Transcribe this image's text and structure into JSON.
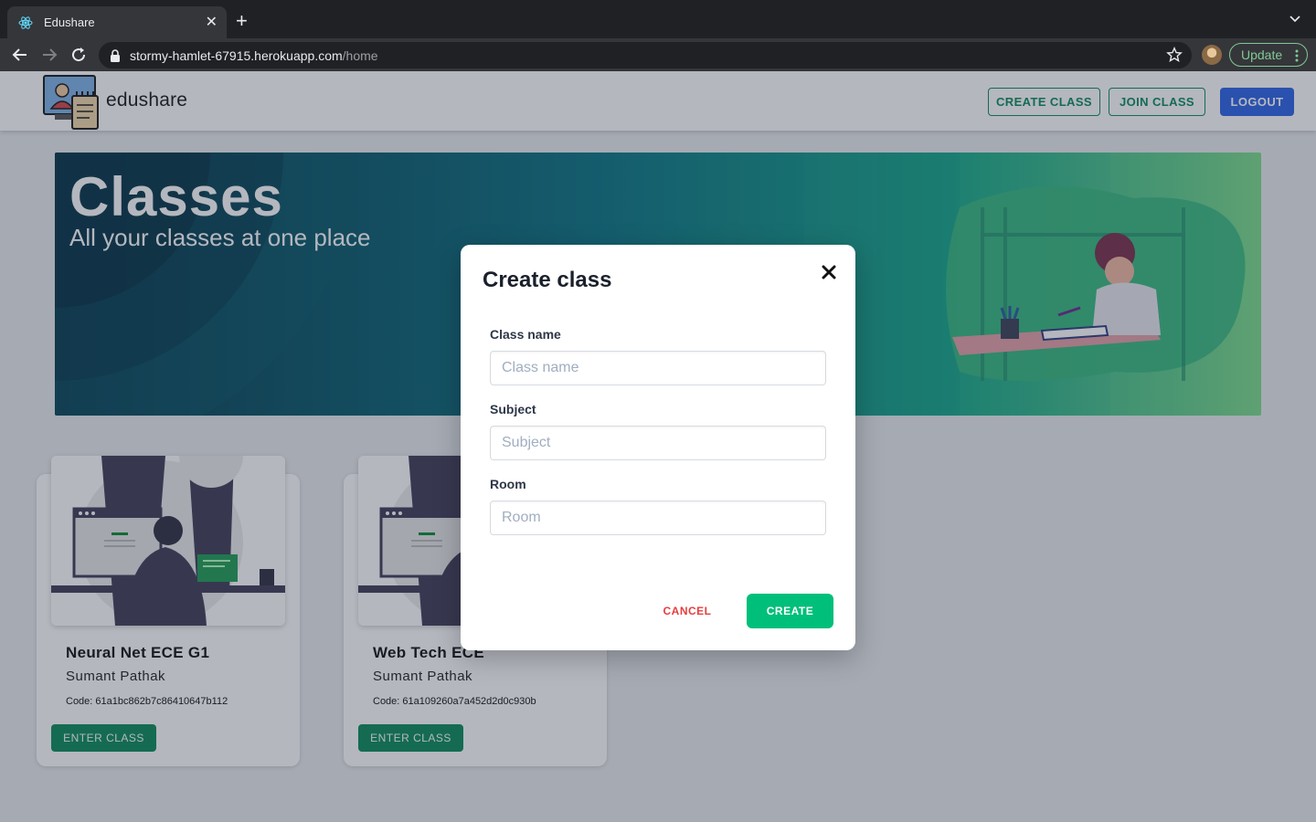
{
  "browser": {
    "tab_title": "Edushare",
    "url_host": "stormy-hamlet-67915.herokuapp.com",
    "url_path": "/home",
    "update_label": "Update"
  },
  "header": {
    "brand": "edushare",
    "create_class_label": "CREATE CLASS",
    "join_class_label": "JOIN CLASS",
    "logout_label": "LOGOUT"
  },
  "banner": {
    "title": "Classes",
    "subtitle": "All your classes at one place"
  },
  "classes": [
    {
      "name": "Neural Net ECE G1",
      "teacher": "Sumant Pathak",
      "code": "Code: 61a1bc862b7c86410647b112",
      "enter_label": "ENTER CLASS"
    },
    {
      "name": "Web Tech ECE",
      "teacher": "Sumant Pathak",
      "code": "Code: 61a109260a7a452d2d0c930b",
      "enter_label": "ENTER CLASS"
    }
  ],
  "modal": {
    "title": "Create class",
    "fields": [
      {
        "label": "Class name",
        "placeholder": "Class name",
        "value": ""
      },
      {
        "label": "Subject",
        "placeholder": "Subject",
        "value": ""
      },
      {
        "label": "Room",
        "placeholder": "Room",
        "value": ""
      }
    ],
    "cancel_label": "CANCEL",
    "create_label": "CREATE"
  },
  "colors": {
    "accent_green": "#0a8a5a",
    "create_green": "#00bf7a",
    "logout_blue": "#2b63e6",
    "cancel_red": "#e53e3e"
  }
}
